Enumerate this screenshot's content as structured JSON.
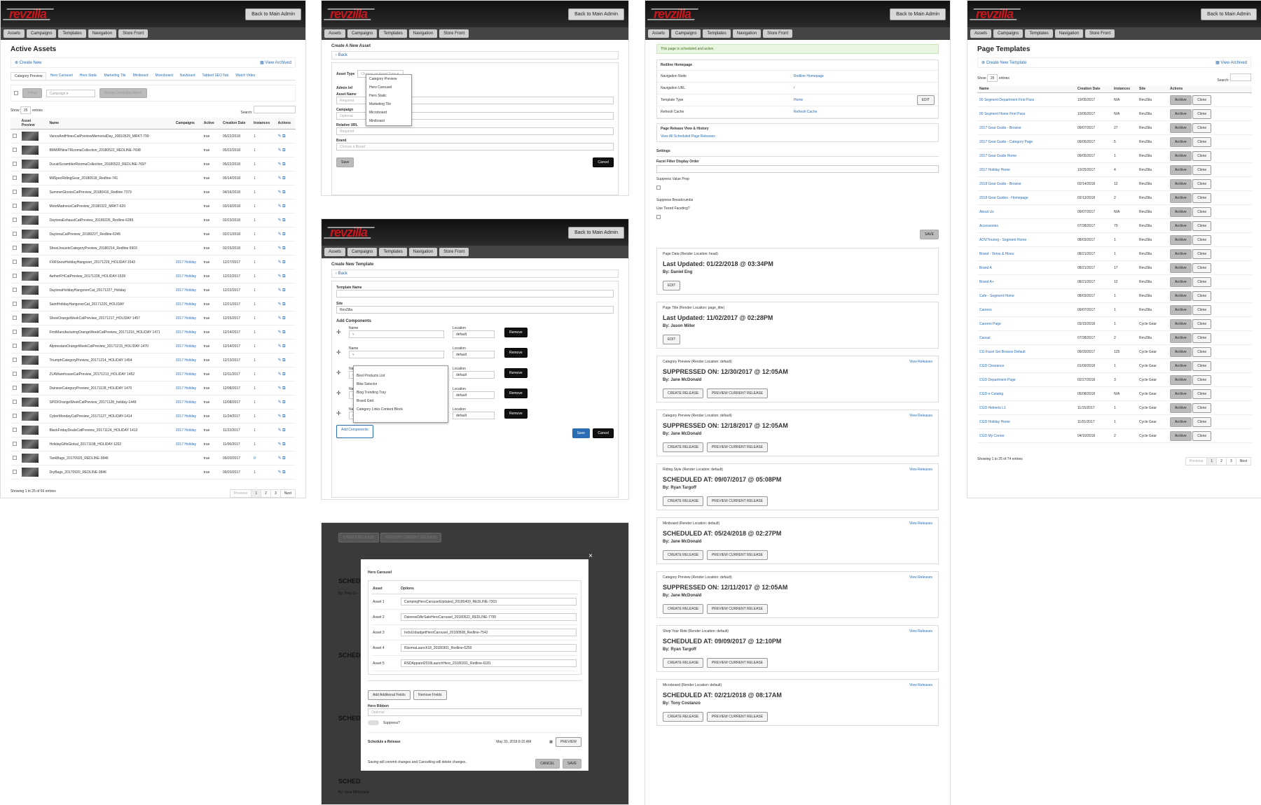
{
  "common": {
    "logo": "revzilla",
    "back": "Back to Main Admin",
    "nav": [
      "Assets",
      "Campaigns",
      "Templates",
      "Navigation",
      "Store Front"
    ]
  },
  "assets": {
    "title": "Active Assets",
    "create": "Create New",
    "view_archived": "View Archived",
    "tabs": [
      "Category Preview",
      "Hero Carousel",
      "Hero Static",
      "Marketing Tile",
      "Miniboard",
      "Monoboard",
      "Navboard",
      "Tabbed SEO Tab",
      "Watch Video"
    ],
    "filter_active": "Active",
    "filter_campaign": "Campaign",
    "assign": "Assign Campaign Name",
    "show": "Show",
    "show_val": "25",
    "entries": "entries",
    "search": "Search:",
    "cols": [
      "Asset Preview",
      "Name",
      "Campaigns",
      "Active",
      "Creation Date",
      "Instances",
      "Actions"
    ],
    "rows": [
      [
        "VanceAndHinesCatPreviewMemorialDay_20810529_MRKT-799",
        "",
        "true",
        "05/22/2018",
        "1"
      ],
      [
        "BMWRNineTRizomaCollection_20180522_REDLINE-7698",
        "",
        "true",
        "05/22/2018",
        "1"
      ],
      [
        "DucatiScramblerRizomaCollection_20180522_REDLINE-7697",
        "",
        "true",
        "05/22/2018",
        "1"
      ],
      [
        "MilSpecRidingGear_20180518_Redline-741",
        "",
        "true",
        "05/14/2018",
        "1"
      ],
      [
        "SummerGlovesCatPreview_20180416_Redline 7379",
        "",
        "true",
        "04/16/2018",
        "1"
      ],
      [
        "MotoMadnessCatPreview_20180322_MRKT-620",
        "",
        "true",
        "03/19/2018",
        "1"
      ],
      [
        "DaytonaExhaustCatPreview_20180226_Redline-6289",
        "",
        "true",
        "02/23/2018",
        "1"
      ],
      [
        "DaytonaCatPreview_20180227_Redline-6345",
        "",
        "true",
        "02/21/2018",
        "1"
      ],
      [
        "ShoeiJosuotsCategoryPreview_20180214_Redline 6903",
        "",
        "true",
        "02/15/2018",
        "1"
      ],
      [
        "FXRSnowHolidayHangover_20171229_HOLIDAY-1543",
        "2017 Holiday",
        "true",
        "12/27/2017",
        "1"
      ],
      [
        "AetherFHCatPreview_20171228_HOLIDAY-1539",
        "2017 Holiday",
        "true",
        "12/22/2017",
        "1"
      ],
      [
        "DaytonaHolidayHangoverCat_20171227_Holiday",
        "2017 Holiday",
        "true",
        "12/22/2017",
        "1"
      ],
      [
        "SaintHolidayHangoverCat_20171226_HOLIDAY",
        "2017 Holiday",
        "true",
        "12/21/2017",
        "1"
      ],
      [
        "ShoeiOrangeWeekCatPreview_20171217_HOLIDAY 1457",
        "2017 Holiday",
        "true",
        "12/15/2017",
        "1"
      ],
      [
        "FirstManufacturingOrangeWeekCatPreview_20171216_HOLIDAY 1471",
        "2017 Holiday",
        "true",
        "12/14/2017",
        "1"
      ],
      [
        "AlpinestarsOrangeWeekCatPreview_20171215_HOLIDAY-1470",
        "2017 Holiday",
        "true",
        "12/14/2017",
        "1"
      ],
      [
        "TriumphCategoryPreview_20171214_HOLIDAY 1454",
        "2017 Holiday",
        "true",
        "12/13/2017",
        "1"
      ],
      [
        "ZLAWarehouseCatPreview_20171213_HOLIDAY 1452",
        "2017 Holiday",
        "true",
        "12/11/2017",
        "1"
      ],
      [
        "DaineseCategoryPreview_20171128_HOLIDAY 1470",
        "2017 Holiday",
        "true",
        "12/08/2017",
        "1"
      ],
      [
        "SPIDIOrangeWeekCatPreview_20171128_holiday-1448",
        "2017 Holiday",
        "true",
        "12/08/2017",
        "1"
      ],
      [
        "CyberMondayCatPreview_20171127_HOLIDAY-1414",
        "2017 Holiday",
        "true",
        "11/24/2017",
        "1"
      ],
      [
        "BlackFridayDealsCatPreview_20171124_HOLIDAY 1413",
        "2017 Holiday",
        "true",
        "11/22/2017",
        "1"
      ],
      [
        "HolidayGiftsGlobal_20171108_HOLIDAY-1202",
        "2017 Holiday",
        "true",
        "11/06/2017",
        "1"
      ],
      [
        "TankBags_20170920_REDLINE-3846",
        "",
        "true",
        "09/20/2017",
        "0"
      ],
      [
        "DryBags_20170920_REDLINE-3846",
        "",
        "true",
        "09/20/2017",
        "1"
      ]
    ],
    "footer": "Showing 1 to 25 of 66 entries",
    "pages": [
      "Previous",
      "1",
      "2",
      "3",
      "Next"
    ]
  },
  "new_asset": {
    "title": "Create A New Asset",
    "back": "Back",
    "asset_type": "Asset Type",
    "choose": "Choose an Asset Type",
    "options": [
      "Category Preview",
      "Hero Carousel",
      "Hero Static",
      "Marketing Tile",
      "Microboard",
      "Miniboard"
    ],
    "admin": "Admin Inf",
    "asset_name": "Asset Name",
    "required": "Required",
    "campaign": "Campaign",
    "optional": "Optional",
    "relative_url": "Relative URL",
    "brand": "Brand",
    "choose_brand": "Choose a Brand",
    "save": "Save",
    "cancel": "Cancel"
  },
  "new_template": {
    "title": "Create New Template",
    "back": "Back",
    "template_name": "Template Name",
    "site": "Site",
    "site_val": "RevZilla",
    "add_components": "Add Components",
    "name": "Name",
    "location": "Location",
    "default": "default",
    "remove": "Remove",
    "options": [
      "Best Products List",
      "Bike Selector",
      "Blog Trending Tray",
      "Brand Grid",
      "Category Links Content Block"
    ],
    "add_btn": "Add Components",
    "save": "Save",
    "cancel": "Cancel"
  },
  "modal": {
    "title": "Hero Carousel",
    "col_asset": "Asset",
    "col_options": "Options",
    "rows": [
      [
        "Asset 1",
        "CampingHeroCarouselUpdated_20180409_REDLINE-7303"
      ],
      [
        "Asset 2",
        "DaineseDAirSaleHeroCarousel_20180522_REDLINE-7795"
      ],
      [
        "Asset 3",
        "IndoUsbudgetHeroCarousel_20180508_Redline-7542"
      ],
      [
        "Asset 4",
        "RizomaLaunch18_20180301_Redline-6250"
      ],
      [
        "Asset 5",
        "RSDApparel2018LaunchHero_20180201_Redline-6181"
      ]
    ],
    "add_fields": "Add Additional Fields",
    "remove_fields": "Remove Fields",
    "hero_ribbon": "Hero Ribbon",
    "optional": "Optional",
    "suppress": "Suppress?",
    "schedule": "Schedule a Release",
    "date": "May 30, 2018 8:15 AM",
    "preview": "PREVIEW",
    "note": "Saving will commit changes and Cancelling will delete changes.",
    "cancel": "CANCEL",
    "save": "SAVE",
    "close": "×",
    "bg_create": "CREATE RELEASE",
    "bg_preview": "PREVIEW CURRENT RELEASE",
    "bg_sched": "SCHED",
    "by_tony": "By: Tony Co",
    "by_jane": "By: Jane McDonald"
  },
  "homepage": {
    "alert": "This page is scheduled and active.",
    "title": "Redline Homepage",
    "info": [
      [
        "Navigation Node",
        "Redline Homepage"
      ],
      [
        "Navigation URL",
        "/"
      ],
      [
        "Template Type",
        "Home"
      ],
      [
        "Refresh Cache",
        "Refresh Cache"
      ]
    ],
    "edit": "EDIT",
    "release_hdr": "Page Release View & History",
    "view_all": "View All Scheduled Page Releases",
    "settings": "Settings",
    "facet": "Facet Filter Display Order",
    "suppress_vp": "Suppress Value Prop",
    "suppress_bc": "Suppress Breadcrumbs",
    "tiered": "Use Tiered Faceting?",
    "save": "SAVE",
    "cards": [
      {
        "head": "Page Data (Render Location: head)",
        "big": "Last Updated: 01/22/2018 @ 03:34PM",
        "by": "By: Daniel Eng",
        "type": "edit"
      },
      {
        "head": "Page Title (Render Location: page_title)",
        "big": "Last Updated: 11/02/2017 @ 02:28PM",
        "by": "By: Jason Miller",
        "type": "edit"
      },
      {
        "head": "Category Preview (Render Location: default)",
        "big": "SUPPRESSED ON: 12/30/2017 @ 12:05AM",
        "by": "By: Jane McDonald",
        "type": "rel"
      },
      {
        "head": "Category Preview (Render Location: default)",
        "big": "SUPPRESSED ON: 12/18/2017 @ 12:05AM",
        "by": "By: Jane McDonald",
        "type": "rel"
      },
      {
        "head": "Riding Style (Render Location: default)",
        "big": "SCHEDULED AT: 09/07/2017 @ 05:08PM",
        "by": "By: Ryan Targoff",
        "type": "rel"
      },
      {
        "head": "Miniboard (Render Location: default)",
        "big": "SCHEDULED AT: 05/24/2018 @ 02:27PM",
        "by": "By: Jane McDonald",
        "type": "rel"
      },
      {
        "head": "Category Preview (Render Location: default)",
        "big": "SUPPRESSED ON: 12/11/2017 @ 12:05AM",
        "by": "By: Jane McDonald",
        "type": "rel"
      },
      {
        "head": "Shop Your Ride (Render Location: default)",
        "big": "SCHEDULED AT: 09/09/2017 @ 12:10PM",
        "by": "By: Ryan Targoff",
        "type": "rel"
      },
      {
        "head": "Microboard (Render Location: default)",
        "big": "SCHEDULED AT: 02/21/2018 @ 08:17AM",
        "by": "By: Tony Costanzo",
        "type": "rel"
      }
    ],
    "view_releases": "View Releases",
    "create_release": "CREATE RELEASE",
    "preview_release": "PREVIEW CURRENT RELEASE"
  },
  "templates": {
    "title": "Page Templates",
    "create": "Create New Template",
    "view_archived": "View Archived",
    "show": "Show",
    "show_val": "25",
    "entries": "entries",
    "search": "Search:",
    "cols": [
      "Name",
      "Creation Date",
      "Instances",
      "Site",
      "Actions"
    ],
    "rows": [
      [
        "00 Segment Department First Pass",
        "10/05/2017",
        "N/A",
        "RevZilla"
      ],
      [
        "00 Segment Home First Pass",
        "10/05/2017",
        "N/A",
        "RevZilla"
      ],
      [
        "2017 Gear Guide - Browse",
        "09/07/2017",
        "27",
        "RevZilla"
      ],
      [
        "2017 Gear Guide - Category Page",
        "09/05/2017",
        "5",
        "RevZilla"
      ],
      [
        "2017 Gear Guide Home",
        "09/05/2017",
        "1",
        "RevZilla"
      ],
      [
        "2017 Holiday Home",
        "10/25/2017",
        "4",
        "RevZilla"
      ],
      [
        "2018 Gear Guide - Browse",
        "02/14/2018",
        "12",
        "RevZilla"
      ],
      [
        "2018 Gear Guides - Homepage",
        "02/13/2018",
        "2",
        "RevZilla"
      ],
      [
        "About Us",
        "09/07/2017",
        "N/A",
        "RevZilla"
      ],
      [
        "Accessories",
        "07/28/2017",
        "70",
        "RevZilla"
      ],
      [
        "ADV/Touring - Segment Home",
        "08/03/2017",
        "1",
        "RevZilla"
      ],
      [
        "Brand - Verse & Hines",
        "08/21/2017",
        "1",
        "RevZilla"
      ],
      [
        "Brand A",
        "08/21/2017",
        "17",
        "RevZilla"
      ],
      [
        "Brand A+",
        "08/21/2017",
        "12",
        "RevZilla"
      ],
      [
        "Cafe - Segment Home",
        "08/03/2017",
        "1",
        "RevZilla"
      ],
      [
        "Careers",
        "09/07/2017",
        "1",
        "RevZilla"
      ],
      [
        "Careers Page",
        "03/15/2018",
        "1",
        "Cycle Gear"
      ],
      [
        "Casual",
        "07/28/2017",
        "2",
        "RevZilla"
      ],
      [
        "CG Facet Set Browse Default",
        "09/20/2017",
        "125",
        "Cycle Gear"
      ],
      [
        "CGD Clearance",
        "01/09/2018",
        "1",
        "Cycle Gear"
      ],
      [
        "CGD Department Page",
        "02/27/2018",
        "3",
        "Cycle Gear"
      ],
      [
        "CGD e-Catalog",
        "05/08/2018",
        "N/A",
        "Cycle Gear"
      ],
      [
        "CGD Helmets L1",
        "11/15/2017",
        "1",
        "Cycle Gear"
      ],
      [
        "CGD Holiday Home",
        "11/01/2017",
        "1",
        "Cycle Gear"
      ],
      [
        "CGD My Corner",
        "04/10/2018",
        "2",
        "Cycle Gear"
      ]
    ],
    "archive": "Archive",
    "clone": "Clone",
    "footer": "Showing 1 to 25 of 74 entries",
    "pages": [
      "Previous",
      "1",
      "2",
      "3",
      "Next"
    ]
  }
}
